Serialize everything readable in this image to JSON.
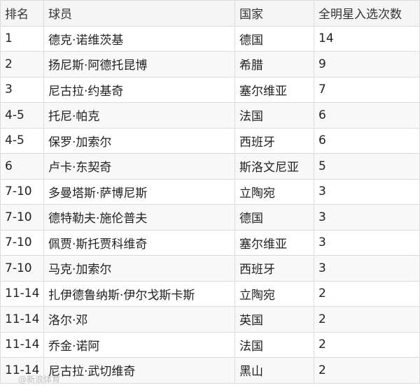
{
  "table": {
    "headers": [
      "排名",
      "球员",
      "国家",
      "全明星入选次数"
    ],
    "rows": [
      [
        "1",
        "德克·诺维茨基",
        "德国",
        "14"
      ],
      [
        "2",
        "扬尼斯·阿德托昆博",
        "希腊",
        "9"
      ],
      [
        "3",
        "尼古拉·约基奇",
        "塞尔维亚",
        "7"
      ],
      [
        "4-5",
        "托尼·帕克",
        "法国",
        "6"
      ],
      [
        "4-5",
        "保罗·加索尔",
        "西班牙",
        "6"
      ],
      [
        "6",
        "卢卡·东契奇",
        "斯洛文尼亚",
        "5"
      ],
      [
        "7-10",
        "多曼塔斯·萨博尼斯",
        "立陶宛",
        "3"
      ],
      [
        "7-10",
        "德特勒夫·施伦普夫",
        "德国",
        "3"
      ],
      [
        "7-10",
        "佩贾·斯托贾科维奇",
        "塞尔维亚",
        "3"
      ],
      [
        "7-10",
        "马克·加索尔",
        "西班牙",
        "3"
      ],
      [
        "11-14",
        "扎伊德鲁纳斯·伊尔戈斯卡斯",
        "立陶宛",
        "2"
      ],
      [
        "11-14",
        "洛尔·邓",
        "英国",
        "2"
      ],
      [
        "11-14",
        "乔金·诺阿",
        "法国",
        "2"
      ],
      [
        "11-14",
        "尼古拉·武切维奇",
        "黑山",
        "2"
      ]
    ]
  },
  "watermark": "@新浪体育"
}
